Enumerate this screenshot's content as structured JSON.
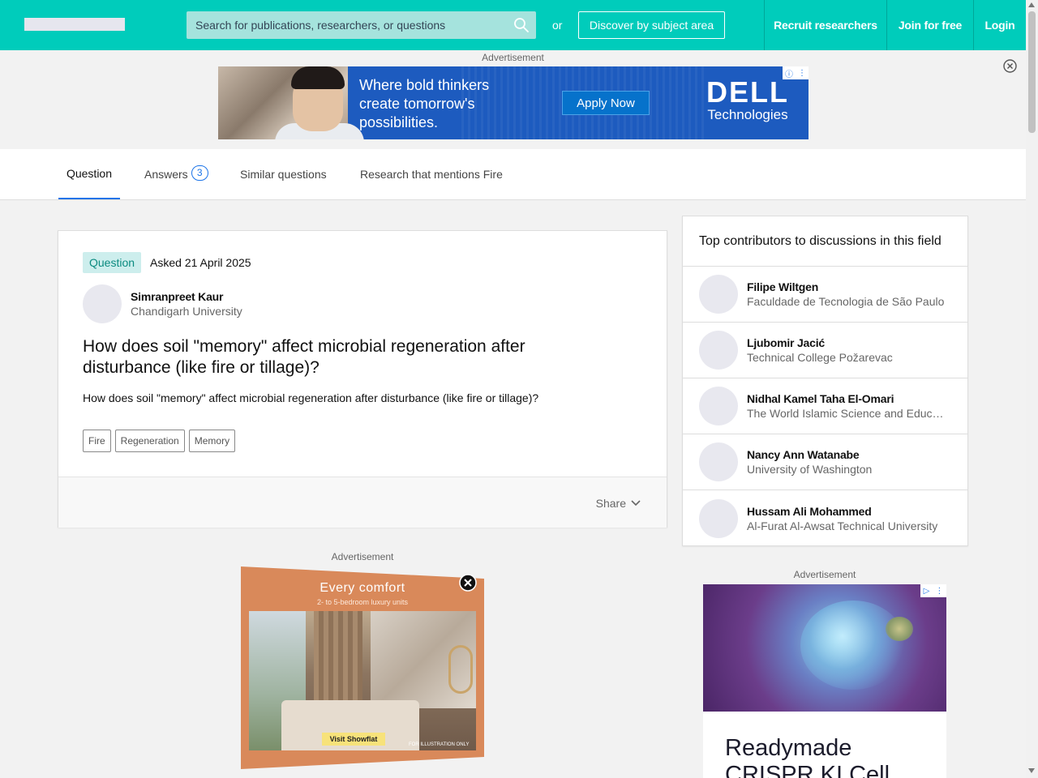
{
  "header": {
    "search_placeholder": "Search for publications, researchers, or questions",
    "or_text": "or",
    "discover_label": "Discover by subject area",
    "recruit_label": "Recruit researchers",
    "join_label": "Join for free",
    "login_label": "Login"
  },
  "ads": {
    "label": "Advertisement",
    "dell": {
      "headline": "Where bold thinkers create tomorrow's possibilities.",
      "cta": "Apply Now",
      "brand": "DELL",
      "brand_sub": "Technologies"
    },
    "comfort": {
      "title": "Every comfort",
      "subtitle": "2- to 5-bedroom luxury units",
      "cta": "Visit Showflat",
      "note": "FOR ILLUSTRATION ONLY"
    },
    "bio": {
      "headline": "Readymade CRISPR KI Cell"
    }
  },
  "tabs": [
    {
      "label": "Question"
    },
    {
      "label": "Answers",
      "count": "3"
    },
    {
      "label": "Similar questions"
    },
    {
      "label": "Research that mentions Fire"
    }
  ],
  "question": {
    "badge": "Question",
    "asked": "Asked 21 April 2025",
    "author_name": "Simranpreet Kaur",
    "author_institution": "Chandigarh University",
    "title": "How does soil \"memory\" affect microbial regeneration after disturbance (like fire or tillage)?",
    "body": "How does soil \"memory\" affect microbial regeneration after disturbance (like fire or tillage)?",
    "tags": [
      "Fire",
      "Regeneration",
      "Memory"
    ],
    "share_label": "Share"
  },
  "contributors": {
    "title": "Top contributors to discussions in this field",
    "items": [
      {
        "name": "Filipe Wiltgen",
        "institution": "Faculdade de Tecnologia de São Paulo"
      },
      {
        "name": "Ljubomir Jacić",
        "institution": "Technical College Požarevac"
      },
      {
        "name": "Nidhal Kamel Taha El-Omari",
        "institution": "The World Islamic Science and Education University"
      },
      {
        "name": "Nancy Ann Watanabe",
        "institution": "University of Washington"
      },
      {
        "name": "Hussam Ali Mohammed",
        "institution": "Al-Furat Al-Awsat Technical University"
      }
    ]
  },
  "colors": {
    "brand": "#00ccbb",
    "accent": "#1a73e8",
    "badge_bg": "#cdeeed"
  }
}
